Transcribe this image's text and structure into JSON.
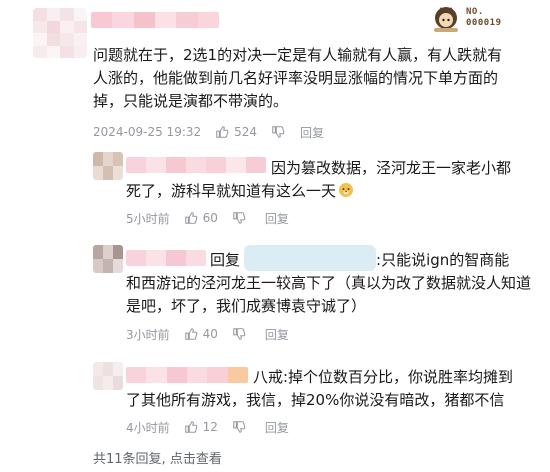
{
  "main_comment": {
    "text_lines": [
      "问题就在于，2选1的对决一定是有人输就有人赢，有人跌就有",
      "人涨的，他能做到前几名好评率没明显涨幅的情况下单方面的",
      "掉，只能说是演都不带演的。"
    ],
    "time": "2024-09-25 19:32",
    "like_count": "524",
    "reply_label": "回复",
    "badge": {
      "line1": "NO.",
      "line2": "000019"
    }
  },
  "replies": [
    {
      "text_lines": [
        "因为篡改数据，泾河龙王一家老小都",
        "死了，游科早就知道有这么一天"
      ],
      "emoji": "doge-emoji",
      "time": "5小时前",
      "like_count": "60",
      "reply_label": "回复"
    },
    {
      "prefix": "回复",
      "text_lines": [
        ":只能说ign的智商能",
        "和西游记的泾河龙王一较高下了（真以为改了数据就没人知道",
        "是吧，坏了，我们成赛博袁守诚了）"
      ],
      "time": "3小时前",
      "like_count": "40",
      "reply_label": "回复"
    },
    {
      "text_lines": [
        "八戒:掉个位数百分比，你说胜率均摊到",
        "了其他所有游戏，我信，掉20%你说没有暗改，猪都不信"
      ],
      "time": "4小时前",
      "like_count": "12",
      "reply_label": "回复"
    }
  ],
  "footer": {
    "summary": "共11条回复,",
    "view_link": "点击查看"
  },
  "colors": {
    "text": "#18191c",
    "meta": "#9499a0",
    "censor_pink": "#f6c7d0"
  }
}
